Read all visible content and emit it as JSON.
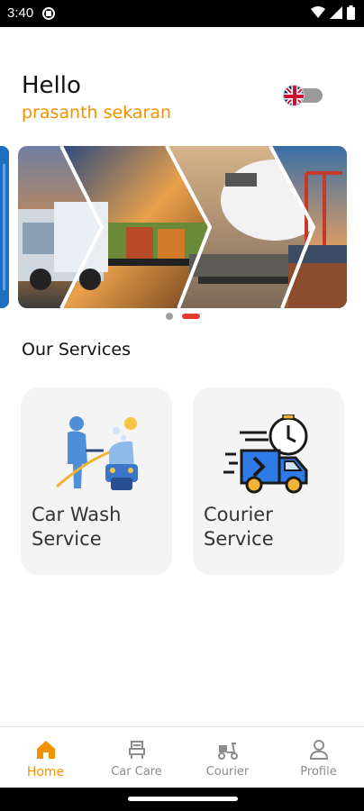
{
  "status_bar": {
    "time": "3:40"
  },
  "greeting": {
    "hello": "Hello",
    "user_name": "prasanth sekaran"
  },
  "language_toggle": {
    "flag": "uk-flag-icon"
  },
  "banner": {
    "active_slide": 2,
    "slide_count": 2
  },
  "services": {
    "title": "Our Services",
    "items": [
      {
        "label": "Car Wash\nService",
        "icon": "car-wash-icon"
      },
      {
        "label": "Courier\nService",
        "icon": "courier-truck-icon"
      }
    ]
  },
  "bottom_nav": {
    "items": [
      {
        "label": "Home",
        "icon": "home-icon",
        "active": true
      },
      {
        "label": "Car Care",
        "icon": "car-seat-icon",
        "active": false
      },
      {
        "label": "Courier",
        "icon": "scooter-icon",
        "active": false
      },
      {
        "label": "Profile",
        "icon": "person-icon",
        "active": false
      }
    ]
  },
  "colors": {
    "accent": "#f39200",
    "active_dot": "#e53935",
    "inactive_dot": "#9e9e9e",
    "card_bg": "#f4f4f4"
  }
}
